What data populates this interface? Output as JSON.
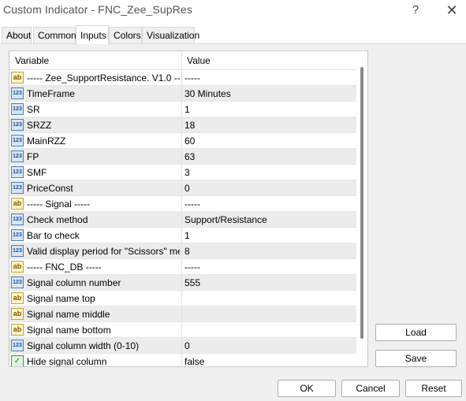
{
  "window": {
    "title": "Custom Indicator - FNC_Zee_SupRes",
    "help": "?",
    "close": "✕"
  },
  "tabs": [
    {
      "label": "About"
    },
    {
      "label": "Common"
    },
    {
      "label": "Inputs"
    },
    {
      "label": "Colors"
    },
    {
      "label": "Visualization"
    }
  ],
  "active_tab": "Inputs",
  "grid": {
    "headers": {
      "variable": "Variable",
      "value": "Value"
    },
    "rows": [
      {
        "type": "str",
        "variable": "----- Zee_SupportResistance. V1.0 -----",
        "value": "-----"
      },
      {
        "type": "num",
        "variable": "TimeFrame",
        "value": "30 Minutes"
      },
      {
        "type": "num",
        "variable": "SR",
        "value": "1"
      },
      {
        "type": "num",
        "variable": "SRZZ",
        "value": "18"
      },
      {
        "type": "num",
        "variable": "MainRZZ",
        "value": "60"
      },
      {
        "type": "num",
        "variable": "FP",
        "value": "63"
      },
      {
        "type": "num",
        "variable": "SMF",
        "value": "3"
      },
      {
        "type": "num",
        "variable": "PriceConst",
        "value": "0"
      },
      {
        "type": "str",
        "variable": "----- Signal -----",
        "value": "-----"
      },
      {
        "type": "num",
        "variable": "Check method",
        "value": "Support/Resistance"
      },
      {
        "type": "num",
        "variable": "Bar to check",
        "value": "1"
      },
      {
        "type": "num",
        "variable": "Valid display period for \"Scissors\" met...",
        "value": "8"
      },
      {
        "type": "str",
        "variable": "----- FNC_DB -----",
        "value": "-----"
      },
      {
        "type": "num",
        "variable": "Signal column number",
        "value": "555"
      },
      {
        "type": "str",
        "variable": "Signal name top",
        "value": ""
      },
      {
        "type": "str",
        "variable": "Signal name middle",
        "value": ""
      },
      {
        "type": "str",
        "variable": "Signal name bottom",
        "value": ""
      },
      {
        "type": "num",
        "variable": "Signal column width (0-10)",
        "value": "0"
      },
      {
        "type": "bool",
        "variable": "Hide signal column",
        "value": "false"
      }
    ]
  },
  "icons": {
    "num": "123",
    "str": "ab",
    "bool": "✓"
  },
  "buttons": {
    "load": "Load",
    "save": "Save",
    "ok": "OK",
    "cancel": "Cancel",
    "reset": "Reset"
  }
}
